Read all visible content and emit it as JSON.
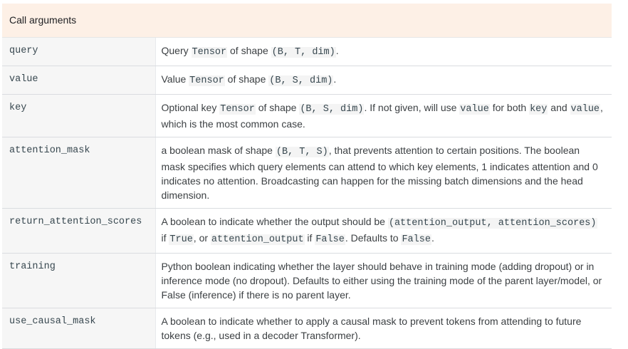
{
  "table": {
    "header": "Call arguments",
    "rows": [
      {
        "name": "query",
        "desc": [
          {
            "t": "text",
            "v": "Query "
          },
          {
            "t": "code",
            "v": "Tensor"
          },
          {
            "t": "text",
            "v": " of shape "
          },
          {
            "t": "code",
            "v": "(B, T, dim)"
          },
          {
            "t": "text",
            "v": "."
          }
        ]
      },
      {
        "name": "value",
        "desc": [
          {
            "t": "text",
            "v": "Value "
          },
          {
            "t": "code",
            "v": "Tensor"
          },
          {
            "t": "text",
            "v": " of shape "
          },
          {
            "t": "code",
            "v": "(B, S, dim)"
          },
          {
            "t": "text",
            "v": "."
          }
        ]
      },
      {
        "name": "key",
        "desc": [
          {
            "t": "text",
            "v": "Optional key "
          },
          {
            "t": "code",
            "v": "Tensor"
          },
          {
            "t": "text",
            "v": " of shape "
          },
          {
            "t": "code",
            "v": "(B, S, dim)"
          },
          {
            "t": "text",
            "v": ". If not given, will use "
          },
          {
            "t": "code",
            "v": "value"
          },
          {
            "t": "text",
            "v": " for both "
          },
          {
            "t": "code",
            "v": "key"
          },
          {
            "t": "text",
            "v": " and "
          },
          {
            "t": "code",
            "v": "value"
          },
          {
            "t": "text",
            "v": ", which is the most common case."
          }
        ]
      },
      {
        "name": "attention_mask",
        "desc": [
          {
            "t": "text",
            "v": "a boolean mask of shape "
          },
          {
            "t": "code",
            "v": "(B, T, S)"
          },
          {
            "t": "text",
            "v": ", that prevents attention to certain positions. The boolean mask specifies which query elements can attend to which key elements, 1 indicates attention and 0 indicates no attention. Broadcasting can happen for the missing batch dimensions and the head dimension."
          }
        ]
      },
      {
        "name": "return_attention_scores",
        "desc": [
          {
            "t": "text",
            "v": "A boolean to indicate whether the output should be "
          },
          {
            "t": "code",
            "v": "(attention_output, attention_scores)"
          },
          {
            "t": "text",
            "v": " if "
          },
          {
            "t": "code",
            "v": "True"
          },
          {
            "t": "text",
            "v": ", or "
          },
          {
            "t": "code",
            "v": "attention_output"
          },
          {
            "t": "text",
            "v": " if "
          },
          {
            "t": "code",
            "v": "False"
          },
          {
            "t": "text",
            "v": ". Defaults to "
          },
          {
            "t": "code",
            "v": "False"
          },
          {
            "t": "text",
            "v": "."
          }
        ]
      },
      {
        "name": "training",
        "desc": [
          {
            "t": "text",
            "v": "Python boolean indicating whether the layer should behave in training mode (adding dropout) or in inference mode (no dropout). Defaults to either using the training mode of the parent layer/model, or False (inference) if there is no parent layer."
          }
        ]
      },
      {
        "name": "use_causal_mask",
        "desc": [
          {
            "t": "text",
            "v": "A boolean to indicate whether to apply a causal mask to prevent tokens from attending to future tokens (e.g., used in a decoder Transformer)."
          }
        ]
      }
    ]
  }
}
